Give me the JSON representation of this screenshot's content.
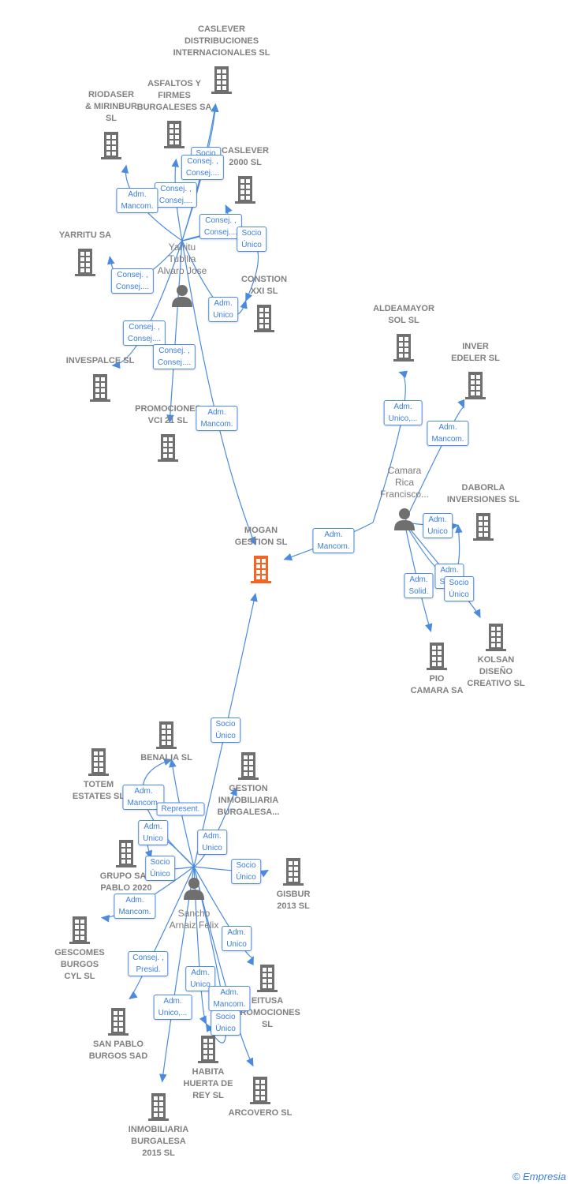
{
  "colors": {
    "edge": "#4a8ae0",
    "node": "#6f6f6f",
    "focus": "#f26522"
  },
  "companies": {
    "caslever_dist": "CASLEVER\nDISTRIBUCIONES\nINTERNACIONALES SL",
    "asfaltos": "ASFALTOS Y\nFIRMES\nBURGALESES SA",
    "riodaser": "RIODASER\n& MIRINBUR\nSL",
    "caslever2000": "CASLEVER\n2000 SL",
    "yarritu_sa": "YARRITU SA",
    "constion": "CONSTION\nXXI  SL",
    "invespalce": "INVESPALCE SL",
    "promociones": "PROMOCIONES\nVCI 21  SL",
    "mogan": "MOGAN\nGESTION  SL",
    "aldeamayor": "ALDEAMAYOR\nSOL SL",
    "inver": "INVER\nEDELER  SL",
    "daborla": "DABORLA\nINVERSIONES SL",
    "pio": "PIO\nCAMARA SA",
    "kolsan": "KOLSAN\nDISEÑO\nCREATIVO SL",
    "benalia": "BENALIA  SL",
    "totem": "TOTEM\nESTATES  SL",
    "gestion": "GESTION\nINMOBILIARIA\nBURGALESA...",
    "grupo": "GRUPO SAN\nPABLO 2020",
    "gisbur": "GISBUR\n2013  SL",
    "gescomes": "GESCOMES\nBURGOS\nCYL SL",
    "eitusa": "EITUSA\nPROMOCIONES\nSL",
    "sanpablo": "SAN PABLO\nBURGOS SAD",
    "habita": "HABITA\nHUERTA DE\nREY SL",
    "arcovero": "ARCOVERO  SL",
    "inmob2015": "INMOBILIARIA\nBURGALESA\n2015  SL"
  },
  "persons": {
    "yarritu": "Yarritu\nTubilla\nAlvaro Jose",
    "camara": "Camara\nRica\nFrancisco...",
    "sancho": "Sancho\nArnaiz Felix"
  },
  "edges": [
    {
      "from": "yarritu",
      "to": "caslever_dist",
      "label": "Socio\nÚnico"
    },
    {
      "from": "yarritu",
      "to": "caslever_dist",
      "label": "Consej. ,\nConsej...."
    },
    {
      "from": "yarritu",
      "to": "asfaltos",
      "label": "Consej. ,\nConsej...."
    },
    {
      "from": "yarritu",
      "to": "riodaser",
      "label": "Adm.\nMancom."
    },
    {
      "from": "yarritu",
      "to": "caslever2000",
      "label": "Consej. ,\nConsej...."
    },
    {
      "from": "yarritu",
      "to": "constion",
      "label": "Socio\nÚnico"
    },
    {
      "from": "yarritu",
      "to": "yarritu_sa",
      "label": "Consej. ,\nConsej...."
    },
    {
      "from": "yarritu",
      "to": "constion",
      "label": "Adm.\nUnico"
    },
    {
      "from": "yarritu",
      "to": "invespalce",
      "label": "Consej. ,\nConsej...."
    },
    {
      "from": "yarritu",
      "to": "promociones",
      "label": "Consej. ,\nConsej...."
    },
    {
      "from": "yarritu",
      "to": "mogan",
      "label": "Adm.\nMancom."
    },
    {
      "from": "camara",
      "to": "aldeamayor",
      "label": "Adm.\nUnico,..."
    },
    {
      "from": "camara",
      "to": "inver",
      "label": "Adm.\nMancom."
    },
    {
      "from": "camara",
      "to": "mogan",
      "label": "Adm.\nMancom."
    },
    {
      "from": "camara",
      "to": "daborla",
      "label": "Adm.\nUnico"
    },
    {
      "from": "camara",
      "to": "daborla",
      "label": "Adm.\nSolid."
    },
    {
      "from": "camara",
      "to": "pio",
      "label": "Adm.\nSolid."
    },
    {
      "from": "camara",
      "to": "kolsan",
      "label": "Socio\nÚnico"
    },
    {
      "from": "sancho",
      "to": "mogan",
      "label": "Socio\nÚnico"
    },
    {
      "from": "sancho",
      "to": "benalia",
      "label": "Adm.\nMancom."
    },
    {
      "from": "sancho",
      "to": "benalia",
      "label": "Represent."
    },
    {
      "from": "sancho",
      "to": "grupo",
      "label": "Adm.\nUnico"
    },
    {
      "from": "sancho",
      "to": "grupo",
      "label": "Socio\nÚnico"
    },
    {
      "from": "sancho",
      "to": "gestion",
      "label": "Adm.\nUnico"
    },
    {
      "from": "sancho",
      "to": "gisbur",
      "label": "Socio\nÚnico"
    },
    {
      "from": "sancho",
      "to": "gescomes",
      "label": "Adm.\nMancom."
    },
    {
      "from": "sancho",
      "to": "eitusa",
      "label": "Adm.\nUnico"
    },
    {
      "from": "sancho",
      "to": "sanpablo",
      "label": "Consej. ,\nPresid."
    },
    {
      "from": "sancho",
      "to": "inmob2015",
      "label": "Adm.\nUnico,..."
    },
    {
      "from": "sancho",
      "to": "habita",
      "label": "Adm.\nUnico"
    },
    {
      "from": "sancho",
      "to": "arcovero",
      "label": "Adm.\nMancom."
    },
    {
      "from": "sancho",
      "to": "habita",
      "label": "Socio\nÚnico"
    }
  ],
  "footer": {
    "copyright": "©",
    "brand": "Empresia"
  }
}
